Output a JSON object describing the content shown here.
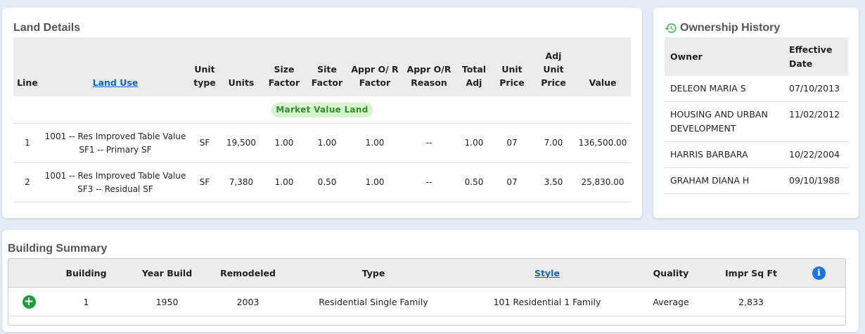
{
  "land": {
    "title": "Land Details",
    "headers": [
      "Line",
      "Land Use",
      "Unit type",
      "Units",
      "Size Factor",
      "Site Factor",
      "Appr O/ R Factor",
      "Appr O/R Reason",
      "Total Adj",
      "Unit Price",
      "Adj Unit Price",
      "Value"
    ],
    "group_label": "Market Value Land",
    "rows": [
      {
        "line": "1",
        "land_use": "1001 -- Res Improved Table Value SF1 -- Primary SF",
        "unit_type": "SF",
        "units": "19,500",
        "size_factor": "1.00",
        "site_factor": "1.00",
        "appr_factor": "1.00",
        "appr_reason": "--",
        "total_adj": "1.00",
        "unit_price": "07",
        "adj_unit_price": "7.00",
        "value": "136,500.00"
      },
      {
        "line": "2",
        "land_use": "1001 -- Res Improved Table Value SF3 -- Residual SF",
        "unit_type": "SF",
        "units": "7,380",
        "size_factor": "1.00",
        "site_factor": "0.50",
        "appr_factor": "1.00",
        "appr_reason": "--",
        "total_adj": "0.50",
        "unit_price": "07",
        "adj_unit_price": "3.50",
        "value": "25,830.00"
      }
    ]
  },
  "ownership": {
    "title": "Ownership History",
    "headers": [
      "Owner",
      "Effective Date"
    ],
    "rows": [
      {
        "owner": "DELEON MARIA S",
        "date": "07/10/2013"
      },
      {
        "owner": "HOUSING AND URBAN DEVELOPMENT",
        "date": "11/02/2012"
      },
      {
        "owner": "HARRIS BARBARA",
        "date": "10/22/2004"
      },
      {
        "owner": "GRAHAM DIANA H",
        "date": "09/10/1988"
      }
    ]
  },
  "building": {
    "title": "Building Summary",
    "headers": [
      "Building",
      "Year Build",
      "Remodeled",
      "Type",
      "Style",
      "Quality",
      "Impr Sq Ft"
    ],
    "rows": [
      {
        "building": "1",
        "year_build": "1950",
        "remodeled": "2003",
        "type": "Residential Single Family",
        "style": "101 Residential 1 Family",
        "quality": "Average",
        "sqft": "2,833"
      }
    ]
  },
  "colors": {
    "accent": "#1565c0",
    "green": "#1e9b3d",
    "badge_bg": "#d6f5cf"
  }
}
